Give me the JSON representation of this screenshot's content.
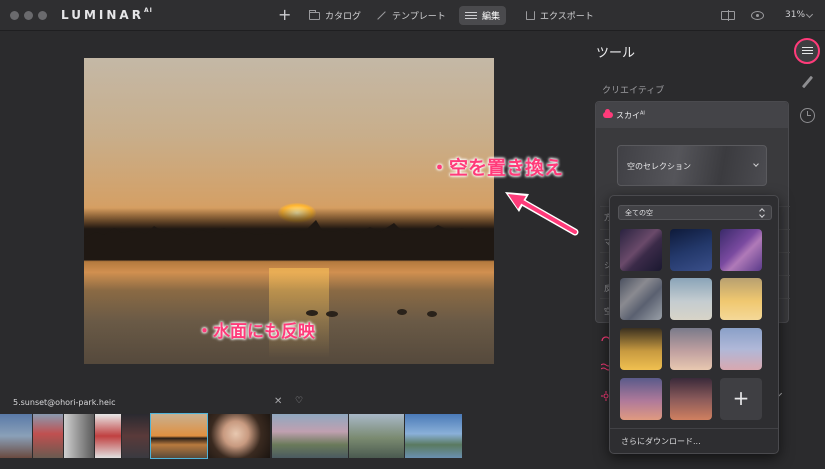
{
  "app": {
    "brand": "LUMINAR",
    "brand_sup": "AI"
  },
  "toolbar": {
    "add_label": "+",
    "nav": [
      {
        "label": "カタログ",
        "icon": "folder-icon"
      },
      {
        "label": "テンプレート",
        "icon": "magic-wand-icon"
      },
      {
        "label": "編集",
        "icon": "sliders-icon",
        "active": true
      },
      {
        "label": "エクスポート",
        "icon": "export-icon"
      }
    ],
    "zoom": "31%"
  },
  "panel": {
    "title": "ツール",
    "section": "クリエイティブ",
    "sky_tool": {
      "title": "スカイ",
      "title_sup": "AI"
    },
    "rows": [
      "方",
      "マ",
      "シ",
      "反",
      "空"
    ],
    "sky_select_label": "空のセレクション",
    "popup": {
      "filter_label": "全ての空",
      "add_label": "+",
      "more_label": "さらにダウンロード..."
    }
  },
  "annotations": {
    "sky_caption": "・空を置き換え",
    "water_caption": "・水面にも反映"
  },
  "filmstrip": {
    "filename": "5.sunset@ohori-park.heic",
    "close_label": "✕",
    "favorite_label": "♡"
  },
  "colors": {
    "accent": "#ff3b7a",
    "selection": "#4fb3d9",
    "background": "#2b2b2d"
  }
}
